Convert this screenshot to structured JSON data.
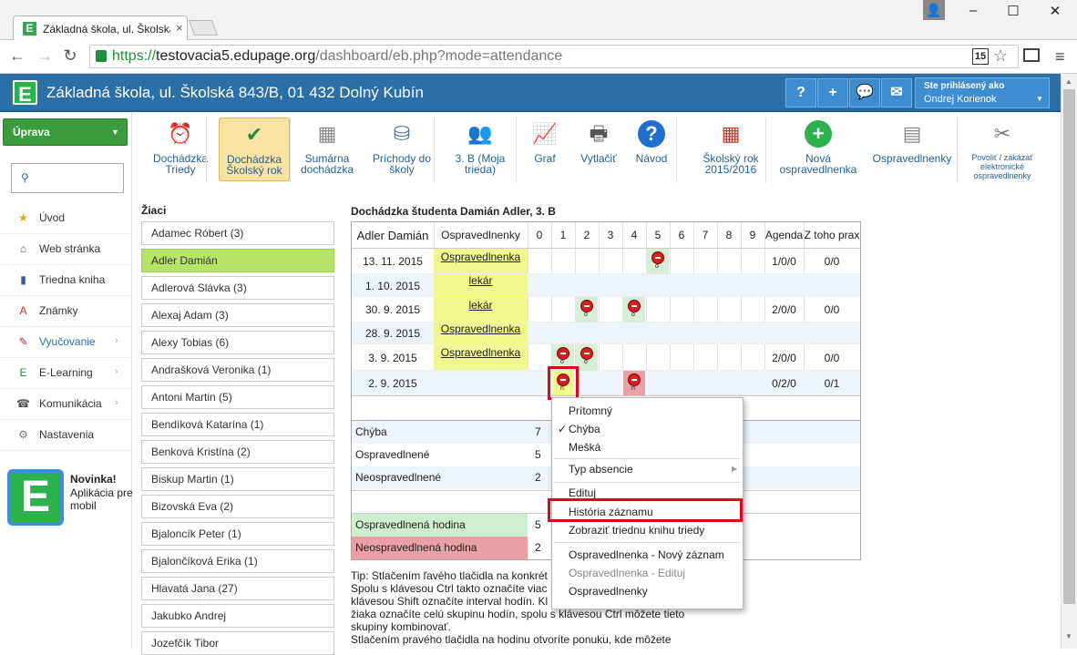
{
  "browser": {
    "tab_title": "Základná škola, ul. Školská",
    "tab_close": "×",
    "url_https": "https://",
    "url_host": "testovacia5.edupage.org",
    "url_path": "/dashboard/eb.php?mode=attendance",
    "ext_badge": "15",
    "win_min": "–",
    "win_max": "☐",
    "win_close": "✕",
    "back": "←",
    "forward": "→",
    "reload": "↻",
    "star": "☆",
    "menu": "≡"
  },
  "app": {
    "logo": "E",
    "school_name": "Základná škola, ul. Školská 843/B, 01 432 Dolný Kubín",
    "header_buttons": [
      "?",
      "+",
      "💬",
      "✉"
    ],
    "user_label": "Ste prihlásený ako",
    "user_name": "Ondrej Korienok"
  },
  "sidebar": {
    "uprava": "Úprava",
    "items": [
      {
        "label": "Úvod",
        "icon": "★",
        "color": "#e2a400",
        "chev": ""
      },
      {
        "label": "Web stránka",
        "icon": "⌂",
        "color": "#b03030",
        "chev": ""
      },
      {
        "label": "Triedna kniha",
        "icon": "▮",
        "color": "#2a5fa8",
        "chev": ""
      },
      {
        "label": "Známky",
        "icon": "A",
        "color": "#c0392b",
        "chev": ""
      },
      {
        "label": "Vyučovanie",
        "icon": "✎",
        "color": "#b03030",
        "chev": "›"
      },
      {
        "label": "E-Learning",
        "icon": "E",
        "color": "#2a8a3a",
        "chev": "›"
      },
      {
        "label": "Komunikácia",
        "icon": "☎",
        "color": "#555",
        "chev": "›"
      },
      {
        "label": "Nastavenia",
        "icon": "⚙",
        "color": "#777",
        "chev": ""
      }
    ],
    "novinka_title": "Novinka!",
    "novinka_text": "Aplikácia pre mobil"
  },
  "toolbar": {
    "items": [
      {
        "l1": "Dochádzka",
        "l2": "Triedy",
        "icon": "⏰"
      },
      {
        "l1": "Dochádzka",
        "l2": "Školský rok",
        "icon": "✔"
      },
      {
        "l1": "Sumárna",
        "l2": "dochádzka",
        "icon": "▦"
      },
      {
        "l1": "Príchody do",
        "l2": "školy",
        "icon": "⛁"
      },
      {
        "l1": "3. B (Moja",
        "l2": "trieda)",
        "icon": "👥"
      },
      {
        "l1": "Graf",
        "l2": "",
        "icon": "📈"
      },
      {
        "l1": "Vytlačiť",
        "l2": "",
        "icon": "🖶"
      },
      {
        "l1": "Návod",
        "l2": "",
        "icon": "?"
      },
      {
        "l1": "Školský rok",
        "l2": "2015/2016",
        "icon": "▦"
      },
      {
        "l1": "Nová",
        "l2": "ospravedlnenka",
        "icon": "+"
      },
      {
        "l1": "Ospravedlnenky",
        "l2": "",
        "icon": "▤"
      },
      {
        "l1": "Povoliť / zakázať",
        "l2": "elektronické",
        "l3": "ospravedlnenky",
        "icon": "✂"
      }
    ]
  },
  "students": {
    "title": "Žiaci",
    "list": [
      "Adamec Róbert (3)",
      "Adler Damián",
      "Adlerová Slávka (3)",
      "Alexaj Adam (3)",
      "Alexy Tobias (6)",
      "Andrašková Veronika (1)",
      "Antoni Martin (5)",
      "Bendíková Katarína (1)",
      "Benková Kristína (2)",
      "Biskup Martin (1)",
      "Bizovská Eva (2)",
      "Bjaloncík Peter (1)",
      "Bjalončíková Erika (1)",
      "Hlavatá Jana (27)",
      "Jakubko Andrej",
      "Jozefčík Tibor"
    ]
  },
  "attendance": {
    "title": "Dochádzka študenta Damián Adler, 3. B",
    "headers": [
      "Adler Damián",
      "Ospravedlnenky",
      "0",
      "1",
      "2",
      "3",
      "4",
      "5",
      "6",
      "7",
      "8",
      "9",
      "Agenda",
      "Z toho prax"
    ],
    "rows": [
      {
        "date": "13. 11. 2015",
        "osp": "Ospravedlnenka",
        "agenda": "1/0/0",
        "prax": "0/0"
      },
      {
        "date": "1. 10. 2015",
        "osp": "lekár",
        "agenda": "",
        "prax": ""
      },
      {
        "date": "30. 9. 2015",
        "osp": "lekár",
        "agenda": "2/0/0",
        "prax": "0/0"
      },
      {
        "date": "28. 9. 2015",
        "osp": "Ospravedlnenka",
        "agenda": "",
        "prax": ""
      },
      {
        "date": "3. 9. 2015",
        "osp": "Ospravedlnenka",
        "agenda": "2/0/0",
        "prax": "0/0"
      },
      {
        "date": "2. 9. 2015",
        "osp": "",
        "agenda": "0/2/0",
        "prax": "0/1"
      }
    ],
    "marks": [
      {
        "row": 0,
        "col": 5,
        "sub": "o",
        "bg": "green"
      },
      {
        "row": 2,
        "col": 2,
        "sub": "o",
        "bg": "green"
      },
      {
        "row": 2,
        "col": 4,
        "sub": "o",
        "bg": "green"
      },
      {
        "row": 4,
        "col": 1,
        "sub": "o",
        "bg": "green"
      },
      {
        "row": 4,
        "col": 2,
        "sub": "o",
        "bg": "green"
      },
      {
        "row": 5,
        "col": 1,
        "sub": "n",
        "bg": "yellow"
      },
      {
        "row": 5,
        "col": 4,
        "sub": "n",
        "bg": "red"
      }
    ]
  },
  "summary": {
    "rows": [
      {
        "label": "Chýba",
        "value": "7",
        "bg": "#eef4fb"
      },
      {
        "label": "Ospravedlnené",
        "value": "5",
        "bg": "#fff"
      },
      {
        "label": "Neospravedlnené",
        "value": "2",
        "bg": "#eef4fb"
      }
    ],
    "osp_hodina": "Ospravedlnená hodina",
    "osp_hodina_value": "5",
    "neosp_hodina": "Neospravedlnená hodina",
    "neosp_hodina_value": "2"
  },
  "tip": {
    "lines": [
      "Tip: Stlačením ľavého tlačidla na konkrét",
      "Spolu s klávesou Ctrl takto označíte viac",
      "klávesou Shift označíte interval hodín. Kl",
      "žiaka označíte celú skupinu hodín, spolu s klávesou Ctrl môžete tieto",
      "skupiny kombinovať.",
      "Stlačením pravého tlačidla na hodinu otvoríte ponuku, kde môžete"
    ]
  },
  "context_menu": {
    "items": [
      {
        "label": "Prítomný",
        "dis": false
      },
      {
        "label": "Chýba",
        "dis": false
      },
      {
        "label": "Mešká",
        "dis": false
      },
      {
        "label": "Typ absencie",
        "dis": false
      },
      {
        "label": "Edituj",
        "dis": false
      },
      {
        "label": "História záznamu",
        "dis": false
      },
      {
        "label": "Zobraziť triednu knihu triedy",
        "dis": false
      },
      {
        "label": "Ospravedlnenka - Nový záznam",
        "dis": false
      },
      {
        "label": "Ospravedlnenka - Edituj",
        "dis": true
      },
      {
        "label": "Ospravedlnenky",
        "dis": false
      }
    ],
    "check": "✓"
  },
  "colors": {
    "header_blue": "#2a6fa8",
    "selected_green": "#b7e36a",
    "highlight_red": "#e4001a",
    "osp_yellow": "#f1f88f"
  }
}
